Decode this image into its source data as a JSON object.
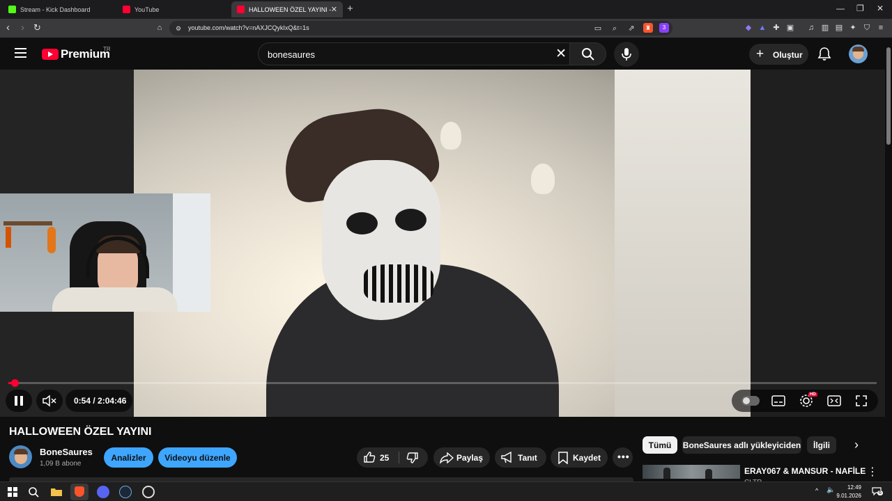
{
  "browser": {
    "tabs": [
      {
        "label": "Stream - Kick Dashboard",
        "favicon_color": "#53fc18"
      },
      {
        "label": "YouTube",
        "favicon_color": "#ff0033"
      },
      {
        "label": "HALLOWEEN ÖZEL YAYINI - You",
        "favicon_color": "#ff0033",
        "active": true
      }
    ],
    "url": "youtube.com/watch?v=nAXJCQykIxQ&t=1s",
    "brave_badge": "3"
  },
  "youtube": {
    "logo_text": "Premium",
    "country": "TR",
    "search_value": "bonesaures",
    "create_label": "Oluştur"
  },
  "player": {
    "current_time": "0:54",
    "duration": "2:04:46",
    "time_display": "0:54 / 2:04:46",
    "progress_fraction": 0.0072,
    "hd_badge": "HD"
  },
  "video": {
    "title": "HALLOWEEN ÖZEL YAYINI",
    "channel_name": "BoneSaures",
    "subscribers": "1,09 B abone",
    "analytics_label": "Analizler",
    "edit_label": "Videoyu düzenle",
    "likes": "25",
    "share_label": "Paylaş",
    "promote_label": "Tanıt",
    "save_label": "Kaydet"
  },
  "sidebar": {
    "chips": [
      "Tümü",
      "BoneSaures adlı yükleyiciden",
      "İlgili"
    ],
    "recommendation": {
      "title": "ERAY067 & MANSUR - NAFİLE",
      "channel": "CLTR"
    }
  },
  "taskbar": {
    "time": "12:49",
    "date": "9.01.2026",
    "notification_count": "6"
  },
  "colors": {
    "accent_red": "#ff0033",
    "button_blue": "#3ea6ff",
    "background": "#0f0f0f"
  }
}
